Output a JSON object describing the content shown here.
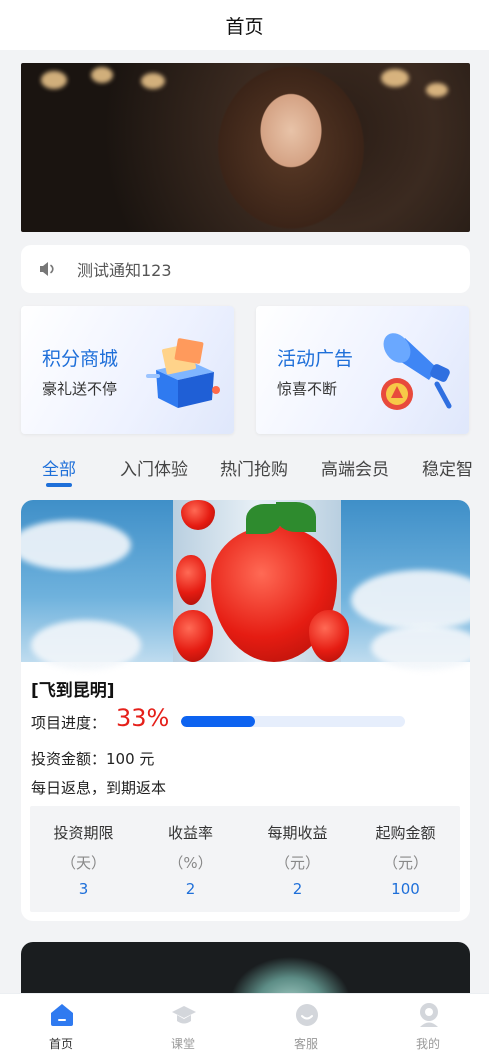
{
  "header": {
    "title": "首页"
  },
  "notice": {
    "text": "测试通知123",
    "icon": "speaker-icon"
  },
  "promos": [
    {
      "title": "积分商城",
      "subtitle": "豪礼送不停",
      "icon": "gift-box-icon"
    },
    {
      "title": "活动广告",
      "subtitle": "惊喜不断",
      "icon": "megaphone-icon"
    }
  ],
  "categories": {
    "active_index": 0,
    "items": [
      "全部",
      "入门体验",
      "热门抢购",
      "高端会员",
      "稳定智"
    ]
  },
  "product": {
    "name": "[飞到昆明]",
    "progress_label": "项目进度：",
    "progress_value": "33%",
    "progress_fraction": 0.33,
    "amount_text": "投资金额：100 元",
    "description": "每日返息，到期返本",
    "stats": [
      {
        "label": "投资期限",
        "unit": "（天）",
        "value": "3"
      },
      {
        "label": "收益率",
        "unit": "（%）",
        "value": "2"
      },
      {
        "label": "每期收益",
        "unit": "（元）",
        "value": "2"
      },
      {
        "label": "起购金额",
        "unit": "（元）",
        "value": "100"
      }
    ]
  },
  "tabbar": {
    "active_index": 0,
    "items": [
      {
        "label": "首页",
        "icon": "home-icon"
      },
      {
        "label": "课堂",
        "icon": "graduation-cap-icon"
      },
      {
        "label": "客服",
        "icon": "customer-service-icon"
      },
      {
        "label": "我的",
        "icon": "user-icon"
      }
    ]
  },
  "colors": {
    "accent": "#1e6fd9",
    "progress_fill": "#0d63f0",
    "highlight": "#e5201a"
  }
}
